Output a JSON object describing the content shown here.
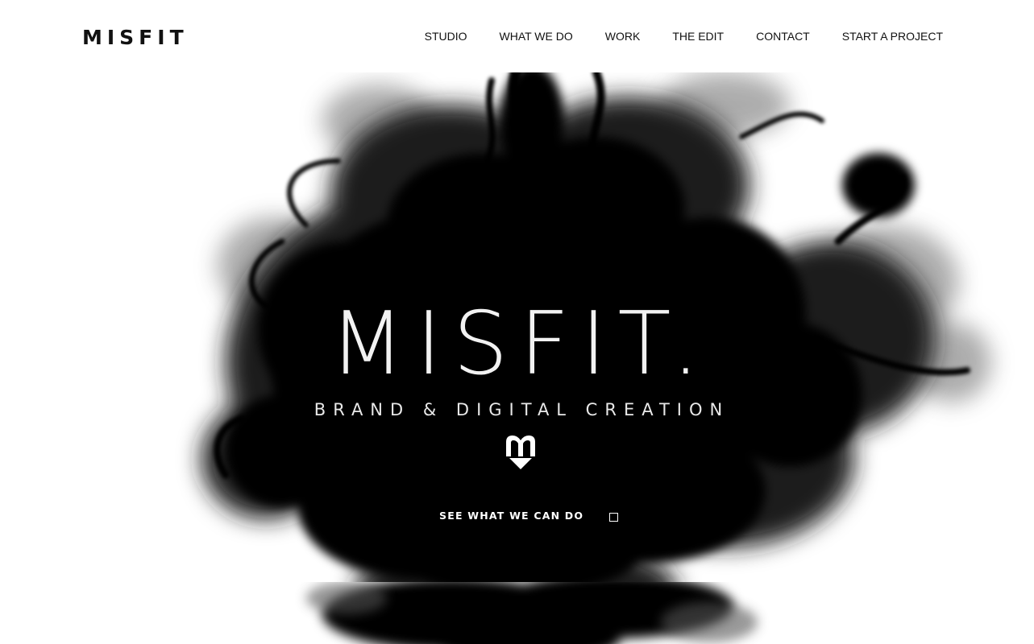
{
  "colors": {
    "ink": "#000000",
    "background": "#ffffff",
    "header_text": "#111111",
    "hero_text": "#f2f2f2"
  },
  "header": {
    "logo": "MISFIT",
    "nav": [
      {
        "label": "STUDIO"
      },
      {
        "label": "WHAT WE DO"
      },
      {
        "label": "WORK"
      },
      {
        "label": "THE EDIT"
      },
      {
        "label": "CONTACT"
      },
      {
        "label": "START A PROJECT"
      }
    ]
  },
  "hero": {
    "title": "MISFIT.",
    "tagline": "BRAND & DIGITAL CREATION",
    "monogram_icon": "misfit-m-arrow-icon",
    "cta_label": "SEE WHAT WE CAN DO",
    "cta_icon": "square-outline-icon"
  }
}
